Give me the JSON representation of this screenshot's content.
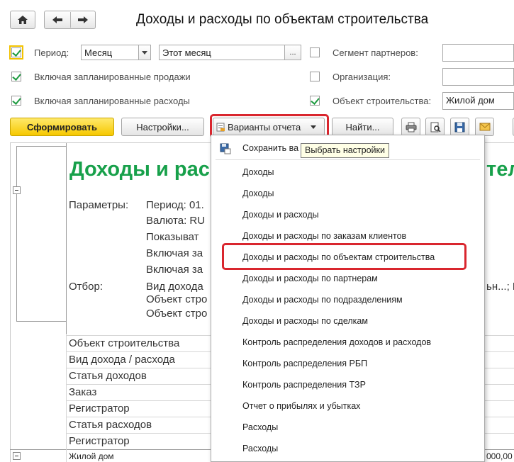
{
  "window": {
    "title": "Доходы и расходы по объектам строительства"
  },
  "nav": {
    "home_icon": "home-icon",
    "back_icon": "arrow-left-icon",
    "forward_icon": "arrow-right-icon"
  },
  "filters": {
    "period_label": "Период:",
    "period_value": "Месяц",
    "period_range": "Этот месяц",
    "period_range_button": "...",
    "segment_label": "Сегмент партнеров:",
    "segment_value": "",
    "org_label": "Организация:",
    "org_value": "",
    "planned_sales_label": "Включая запланированные продажи",
    "planned_expenses_label": "Включая запланированные расходы",
    "object_label": "Объект строительства:",
    "object_value": "Жилой дом"
  },
  "toolbar": {
    "generate": "Сформировать",
    "settings": "Настройки...",
    "variants": "Варианты отчета",
    "find": "Найти..."
  },
  "report": {
    "title": "Доходы и рас",
    "title_tail": "тел",
    "params_label": "Параметры:",
    "params": [
      "Период: 01.",
      "Валюта: RU",
      "Показыват",
      "Включая за",
      "Включая за"
    ],
    "filter_label": "Отбор:",
    "filters": [
      "Вид дохода",
      "Объект стро",
      "Объект стро"
    ],
    "filter_tail": "ьн...; Р",
    "groupings": [
      "Объект строительства",
      "Вид дохода / расхода",
      "Статья доходов",
      "Заказ",
      "Регистратор",
      "Статья расходов",
      "Регистратор"
    ],
    "row_label": "Жилой дом",
    "row_value": "3 000,00"
  },
  "menu": {
    "save_item": "Сохранить ва",
    "tooltip": "Выбрать настройки",
    "items": [
      "Доходы",
      "Доходы",
      "Доходы и расходы",
      "Доходы и расходы по заказам клиентов",
      "Доходы и расходы по объектам строительства",
      "Доходы и расходы по партнерам",
      "Доходы и расходы по подразделениям",
      "Доходы и расходы по сделкам",
      "Контроль распределения доходов и расходов",
      "Контроль распределения РБП",
      "Контроль распределения ТЗР",
      "Отчет о прибылях и убытках",
      "Расходы",
      "Расходы"
    ]
  },
  "colors": {
    "accent_green": "#17a04a",
    "highlight_red": "#d9262e",
    "primary_yellow": "#f6c800"
  }
}
